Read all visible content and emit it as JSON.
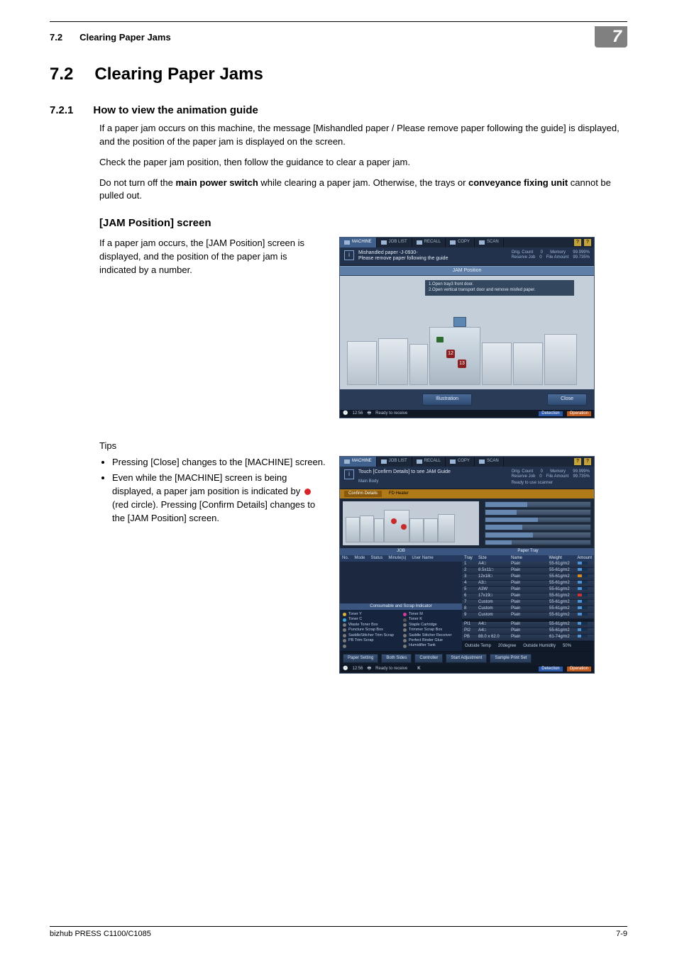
{
  "header": {
    "section_number": "7.2",
    "section_title": "Clearing Paper Jams",
    "chapter_badge": "7"
  },
  "h1": {
    "number": "7.2",
    "title": "Clearing Paper Jams"
  },
  "h2": {
    "number": "7.2.1",
    "title": "How to view the animation guide"
  },
  "intro": {
    "p1": "If a paper jam occurs on this machine, the message [Mishandled paper / Please remove paper following the guide] is displayed, and the position of the paper jam is displayed on the screen.",
    "p2": "Check the paper jam position, then follow the guidance to clear a paper jam.",
    "p3a": "Do not turn off the ",
    "p3b": "main power switch",
    "p3c": " while clearing a paper jam. Otherwise, the trays or ",
    "p3d": "conveyance fixing unit",
    "p3e": " cannot be pulled out."
  },
  "h3": "[JAM Position] screen",
  "jam_para": "If a paper jam occurs, the [JAM Position] screen is displayed, and the position of the paper jam is indicated by a number.",
  "tips_label": "Tips",
  "tips": {
    "t1": "Pressing [Close] changes to the [MACHINE] screen.",
    "t2a": "Even while the [MACHINE] screen is being displayed, a paper jam position is indicated by ",
    "t2b": " (red circle). Pressing [Confirm Details] changes to the [JAM Position] screen."
  },
  "screenshot1": {
    "tabs": {
      "machine": "MACHINE",
      "joblist": "JOB LIST",
      "recall": "RECALL",
      "copy": "COPY",
      "scan": "SCAN"
    },
    "msg_line1": "Mishandled paper  -J-0930-",
    "msg_line2": "Please remove paper following the guide",
    "meters": {
      "r1a": "Orig. Count",
      "r1b": "0",
      "r1c": "Memory",
      "r1d": "99.999%",
      "r2a": "Reserve Job",
      "r2b": "0",
      "r2c": "File Amount",
      "r2d": "99.735%"
    },
    "title": "JAM Position",
    "tip1": "1.Open tray3 front door.",
    "tip2": "2.Open vertical transport door and remove misfed paper.",
    "illustration_btn": "Illustration",
    "close_btn": "Close",
    "status_time": "12:56",
    "status_text": "Ready to receive",
    "chip1": "Detection",
    "chip2": "Operation"
  },
  "screenshot2": {
    "tabs": {
      "machine": "MACHINE",
      "joblist": "JOB LIST",
      "recall": "RECALL",
      "copy": "COPY",
      "scan": "SCAN"
    },
    "msg": "Touch [Confirm Details] to see JAM Guide",
    "mainbody": "Main Body",
    "meters": {
      "r1a": "Orig. Count",
      "r1b": "0",
      "r1c": "Memory",
      "r1d": "99.999%",
      "r2a": "Reserve Job",
      "r2b": "0",
      "r2c": "File Amount",
      "r2d": "99.735%",
      "ready": "Ready to use scanner"
    },
    "warn_btn": "Confirm Details",
    "warn_txt": "FD Heater",
    "job_head": "JOB",
    "cols": {
      "no": "No.",
      "mode": "Mode",
      "status": "Status",
      "min": "Minute(s)",
      "user": "User Name"
    },
    "paper_head": "Paper Tray",
    "pt_cols": {
      "tray": "Tray",
      "size": "Size",
      "name": "Name",
      "weight": "Weight",
      "amount": "Amount"
    },
    "trays": [
      {
        "tray": "1",
        "size": "A4□",
        "name": "Plain",
        "weight": "55-61g/m2",
        "lvl": 40
      },
      {
        "tray": "2",
        "size": "8.5x11□",
        "name": "Plain",
        "weight": "55-61g/m2",
        "lvl": 40
      },
      {
        "tray": "3",
        "size": "12x18□",
        "name": "Plain",
        "weight": "55-61g/m2",
        "lvl": 40,
        "warn": true
      },
      {
        "tray": "4",
        "size": "A3□",
        "name": "Plain",
        "weight": "55-61g/m2",
        "lvl": 40
      },
      {
        "tray": "5",
        "size": "A3W",
        "name": "Plain",
        "weight": "55-61g/m2",
        "lvl": 40
      },
      {
        "tray": "6",
        "size": "17x19□",
        "name": "Plain",
        "weight": "55-61g/m2",
        "lvl": 40,
        "bad": true
      },
      {
        "tray": "7",
        "size": "Custom",
        "name": "Plain",
        "weight": "55-61g/m2",
        "lvl": 40
      },
      {
        "tray": "8",
        "size": "Custom",
        "name": "Plain",
        "weight": "55-61g/m2",
        "lvl": 40
      },
      {
        "tray": "9",
        "size": "Custom",
        "name": "Plain",
        "weight": "55-61g/m2",
        "lvl": 40
      }
    ],
    "pi_rows": [
      {
        "tray": "PI1",
        "size": "A4□",
        "name": "Plain",
        "weight": "55-61g/m2"
      },
      {
        "tray": "PI2",
        "size": "A4□",
        "name": "Plain",
        "weight": "55-61g/m2"
      },
      {
        "tray": "PB",
        "size": "88.0 x 62.0",
        "name": "Plain",
        "weight": "61-74g/m2"
      }
    ],
    "consum_head": "Consumable and Scrap Indicator",
    "consumables": [
      "Toner Y",
      "Toner M",
      "Toner C",
      "Toner K",
      "Waste Toner Box",
      "Staple Cartridge",
      "Puncture Scrap Box",
      "Trimmer Scrap Box",
      "SaddleStitcher Trim Scrap",
      "Saddle Stitcher Receiver",
      "PB Trim Scrap",
      "Perfect Binder Glue",
      "",
      "Humidifier Tank"
    ],
    "env": {
      "t": "Outside Temp",
      "tv": "20degree",
      "h": "Outside Humidity",
      "hv": "50%"
    },
    "btns": {
      "paper": "Paper Setting",
      "both": "Both Sides",
      "controller": "Controller",
      "eject": "Start Adjustment",
      "sample": "Sample Print Set"
    },
    "status_time": "12:56",
    "status_text": "Ready to receive",
    "chip1": "Detection",
    "chip2": "Operation",
    "k_label": "K"
  },
  "footer": {
    "left": "bizhub PRESS C1100/C1085",
    "right": "7-9"
  }
}
